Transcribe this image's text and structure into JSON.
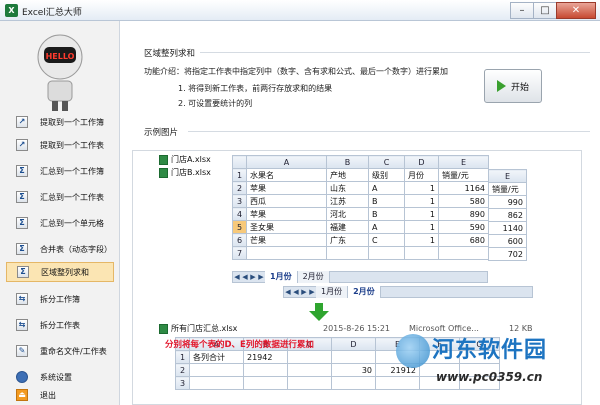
{
  "window": {
    "title": "Excel汇总大师",
    "minimize": "–",
    "maximize": "□",
    "close": "✕"
  },
  "sidebar": {
    "items": [
      {
        "label": "提取到一个工作簿",
        "icon": "extract-workbook-icon"
      },
      {
        "label": "提取到一个工作表",
        "icon": "extract-sheet-icon"
      },
      {
        "label": "汇总到一个工作簿",
        "icon": "sum-workbook-icon"
      },
      {
        "label": "汇总到一个工作表",
        "icon": "sum-sheet-icon"
      },
      {
        "label": "汇总到一个单元格",
        "icon": "sum-cell-icon"
      },
      {
        "label": "合并表（动态字段）",
        "icon": "merge-table-icon"
      },
      {
        "label": "区域整列求和",
        "icon": "column-sum-icon"
      },
      {
        "label": "拆分工作簿",
        "icon": "split-workbook-icon"
      },
      {
        "label": "拆分工作表",
        "icon": "split-sheet-icon"
      },
      {
        "label": "重命名文件/工作表",
        "icon": "rename-icon"
      },
      {
        "label": "系统设置",
        "icon": "settings-icon"
      },
      {
        "label": "退出",
        "icon": "exit-icon"
      }
    ],
    "robot_text": "HELLO"
  },
  "main": {
    "section_title": "区域整列求和",
    "function_intro": "功能介绍：将指定工作表中指定列中（数字、含有求和公式、最后一个数字）进行累加",
    "points": [
      "1. 将得到新工作表，前两行存放求和的结果",
      "2. 可设置要统计的列"
    ],
    "start_label": "开始",
    "example_title": "示例图片"
  },
  "example": {
    "source_files": [
      "门店A.xlsx",
      "门店B.xlsx"
    ],
    "sheet_a": {
      "col_headers": [
        "A",
        "B",
        "C",
        "D",
        "E"
      ],
      "rows": [
        [
          "1",
          "水果名",
          "产地",
          "级别",
          "月份",
          "销量/元"
        ],
        [
          "2",
          "苹果",
          "山东",
          "A",
          "1",
          "1164"
        ],
        [
          "3",
          "西瓜",
          "江苏",
          "B",
          "1",
          "580"
        ],
        [
          "4",
          "苹果",
          "河北",
          "B",
          "1",
          "890"
        ],
        [
          "5",
          "圣女果",
          "福建",
          "A",
          "1",
          "590"
        ],
        [
          "6",
          "芒果",
          "广东",
          "C",
          "1",
          "680"
        ],
        [
          "7",
          "",
          "",
          "",
          "",
          ""
        ]
      ]
    },
    "tabs_a": [
      "1月份",
      "2月份"
    ],
    "tabs_b": [
      "1月份",
      "2月份"
    ],
    "side_sheet": {
      "header": "E",
      "label": "销量/元",
      "values": [
        "990",
        "862",
        "1140",
        "600",
        "702"
      ]
    },
    "summary_file": {
      "name": "所有门店汇总.xlsx",
      "date": "2015-8-26 15:21",
      "type": "Microsoft Office...",
      "size": "12 KB"
    },
    "summary_sheet": {
      "col_headers": [
        "A",
        "B",
        "C",
        "D",
        "E",
        "F",
        "G"
      ],
      "rows": [
        [
          "1",
          "各列合计",
          "21942",
          "",
          "",
          "",
          "",
          ""
        ],
        [
          "2",
          "",
          "",
          "",
          "30",
          "21912",
          "",
          ""
        ],
        [
          "3",
          "",
          "",
          "",
          "",
          "",
          "",
          ""
        ]
      ]
    },
    "note": "分别将每个表的D、E列的数据进行累加"
  },
  "watermark": {
    "text": "河东软件园",
    "url": "www.pc0359.cn"
  }
}
